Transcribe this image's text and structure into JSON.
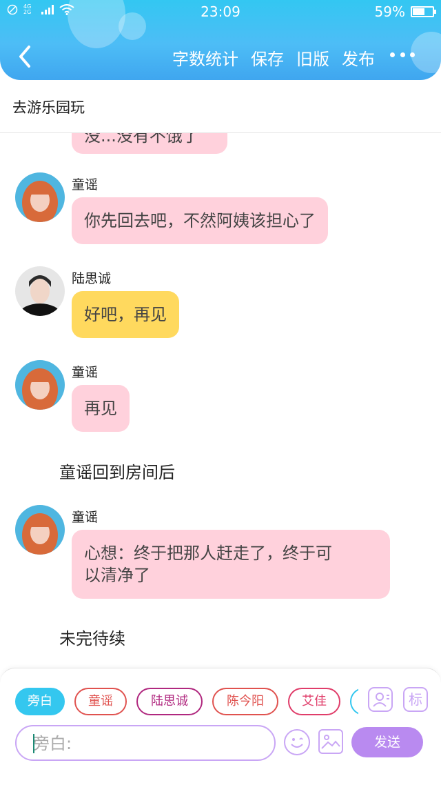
{
  "status_bar": {
    "network": "4G 2G",
    "time": "23:09",
    "battery_text": "59%",
    "battery_level": 0.59
  },
  "nav": {
    "back_icon": "chevron-left-icon",
    "actions": [
      "字数统计",
      "保存",
      "旧版",
      "发布"
    ],
    "more_icon": "more-dots-icon"
  },
  "story": {
    "title": "去游乐园玩"
  },
  "messages": [
    {
      "kind": "partial",
      "text": "没...没有不饿了"
    },
    {
      "kind": "speech",
      "speaker": "童谣",
      "text": "你先回去吧，不然阿姨该担心了",
      "color": "#ffd1dc"
    },
    {
      "kind": "speech",
      "speaker": "陆思诚",
      "text": "好吧，再见",
      "color": "#ffd95e"
    },
    {
      "kind": "speech",
      "speaker": "童谣",
      "text": "再见",
      "color": "#ffd1dc"
    },
    {
      "kind": "narration",
      "text": "童谣回到房间后"
    },
    {
      "kind": "speech",
      "speaker": "童谣",
      "text_lines": [
        "心想：终于把那人赶走了，终于可",
        "以清净了"
      ],
      "color": "#ffd1dc"
    },
    {
      "kind": "narration",
      "text": "未完待续"
    }
  ],
  "composer": {
    "roles": [
      {
        "label": "旁白",
        "active": true,
        "color": "#34c7ef"
      },
      {
        "label": "童谣",
        "active": false,
        "color": "#e0524f"
      },
      {
        "label": "陆思诚",
        "active": false,
        "color": "#b0287f"
      },
      {
        "label": "陈今阳",
        "active": false,
        "color": "#e0524f"
      },
      {
        "label": "艾佳",
        "active": false,
        "color": "#e03d6a"
      }
    ],
    "role_tool_icon": "person-card-icon",
    "tag_tool_label": "标",
    "input_placeholder": "旁白:",
    "emoji_icon": "smiley-icon",
    "image_icon": "image-icon",
    "send_label": "发送"
  },
  "colors": {
    "header_gradient_top": "#33c7f2",
    "accent_purple": "#b98af0",
    "bubble_pink": "#ffd1dc",
    "bubble_yellow": "#ffd95e"
  }
}
